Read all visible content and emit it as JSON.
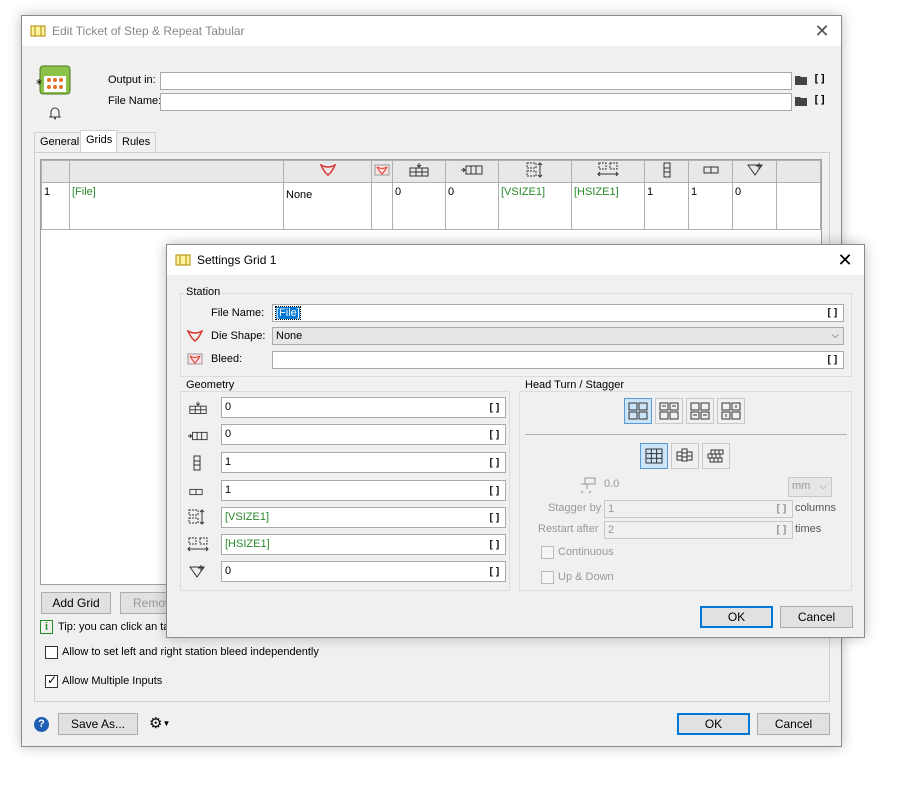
{
  "main_dialog": {
    "title": "Edit Ticket of Step & Repeat Tabular",
    "output_in_label": "Output in:",
    "output_in_value": "",
    "file_name_label": "File Name:",
    "file_name_value": "",
    "tabs": [
      "General",
      "Grids",
      "Rules"
    ],
    "table": {
      "row": {
        "index": "1",
        "file": "[File]",
        "die_shape": "None",
        "bleed": "",
        "col1": "0",
        "col2": "0",
        "vsize": "[VSIZE1]",
        "hsize": "[HSIZE1]",
        "col5": "1",
        "col6": "1",
        "col7": "0"
      }
    },
    "add_grid_label": "Add Grid",
    "remove_label": "Remov",
    "tip_text": "Tip: you can click an tal",
    "allow_bleed_label": "Allow to set left and right station bleed independently",
    "allow_multiple_label": "Allow Multiple Inputs",
    "save_as_label": "Save As...",
    "ok_label": "OK",
    "cancel_label": "Cancel"
  },
  "settings_dialog": {
    "title": "Settings Grid 1",
    "station_group": "Station",
    "file_name_label": "File Name:",
    "file_name_value": "[File]",
    "die_shape_label": "Die Shape:",
    "die_shape_value": "None",
    "bleed_label": "Bleed:",
    "bleed_value": "",
    "geometry_group": "Geometry",
    "geometry_values": [
      "0",
      "0",
      "1",
      "1",
      "[VSIZE1]",
      "[HSIZE1]",
      "0"
    ],
    "head_turn_group": "Head Turn / Stagger",
    "offset_value": "0.0",
    "unit_value": "mm",
    "stagger_by_label": "Stagger by",
    "stagger_by_value": "1",
    "stagger_unit": "columns",
    "restart_after_label": "Restart after",
    "restart_after_value": "2",
    "restart_unit": "times",
    "continuous_label": "Continuous",
    "up_down_label": "Up & Down",
    "ok_label": "OK",
    "cancel_label": "Cancel"
  },
  "icons": {
    "bracket_glyph": "[]",
    "ticket": "ticket-icon",
    "folder": "folder-icon",
    "die_shape": "die-shape-icon",
    "bleed": "bleed-icon"
  },
  "colors": {
    "accent": "#0078d7",
    "green_value": "#2a8a2a",
    "die_red": "#d9342b"
  }
}
